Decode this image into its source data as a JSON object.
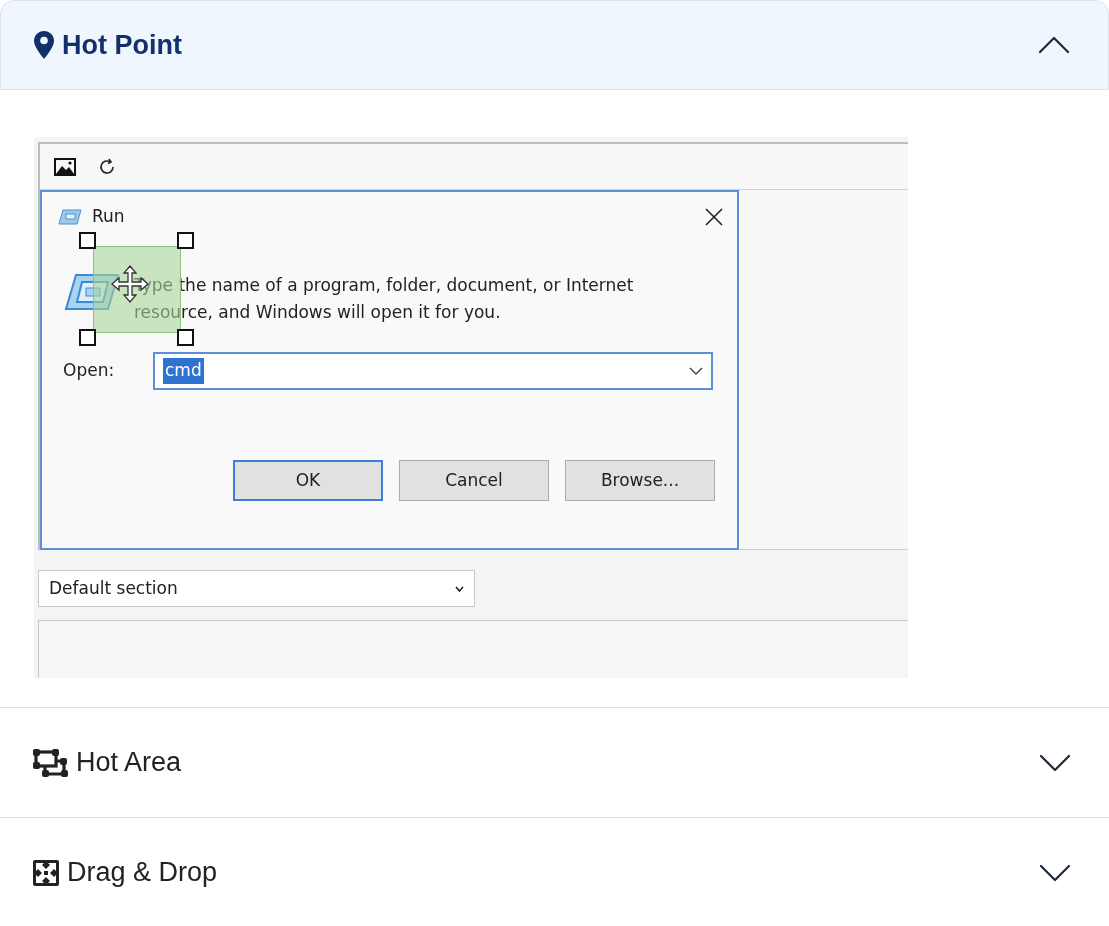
{
  "sections": [
    {
      "title": "Hot Point",
      "kind": "pin",
      "expanded": true,
      "content": {
        "dialog": {
          "title": "Run",
          "message": "Type the name of a program, folder, document, or Internet resource, and Windows will open it for you.",
          "open_label": "Open:",
          "open_value": "cmd",
          "buttons": [
            {
              "label": "OK",
              "selected": true
            },
            {
              "label": "Cancel",
              "selected": false
            },
            {
              "label": "Browse...",
              "selected": false
            }
          ]
        },
        "section_select": {
          "value": "Default section"
        }
      }
    },
    {
      "title": "Hot Area",
      "kind": "area",
      "expanded": false
    },
    {
      "title": "Drag & Drop",
      "kind": "drag",
      "expanded": false
    }
  ]
}
